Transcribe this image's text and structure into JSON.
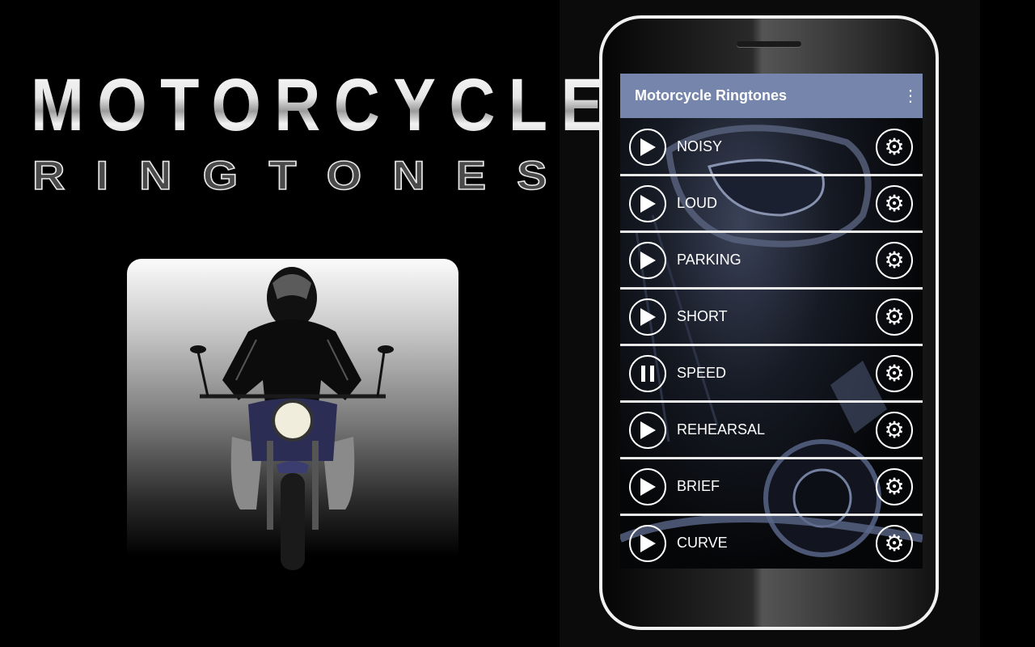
{
  "banner": {
    "title_line1": "MOTORCYCLE",
    "title_line2": "RINGTONES"
  },
  "app": {
    "title": "Motorcycle Ringtones",
    "menu_icon": "more-vert-icon",
    "accent_color": "#7585ab",
    "ringtones": [
      {
        "name": "NOISY",
        "state": "stopped"
      },
      {
        "name": "LOUD",
        "state": "stopped"
      },
      {
        "name": "PARKING",
        "state": "stopped"
      },
      {
        "name": "SHORT",
        "state": "stopped"
      },
      {
        "name": "SPEED",
        "state": "playing"
      },
      {
        "name": "REHEARSAL",
        "state": "stopped"
      },
      {
        "name": "BRIEF",
        "state": "stopped"
      },
      {
        "name": "CURVE",
        "state": "stopped"
      }
    ]
  }
}
